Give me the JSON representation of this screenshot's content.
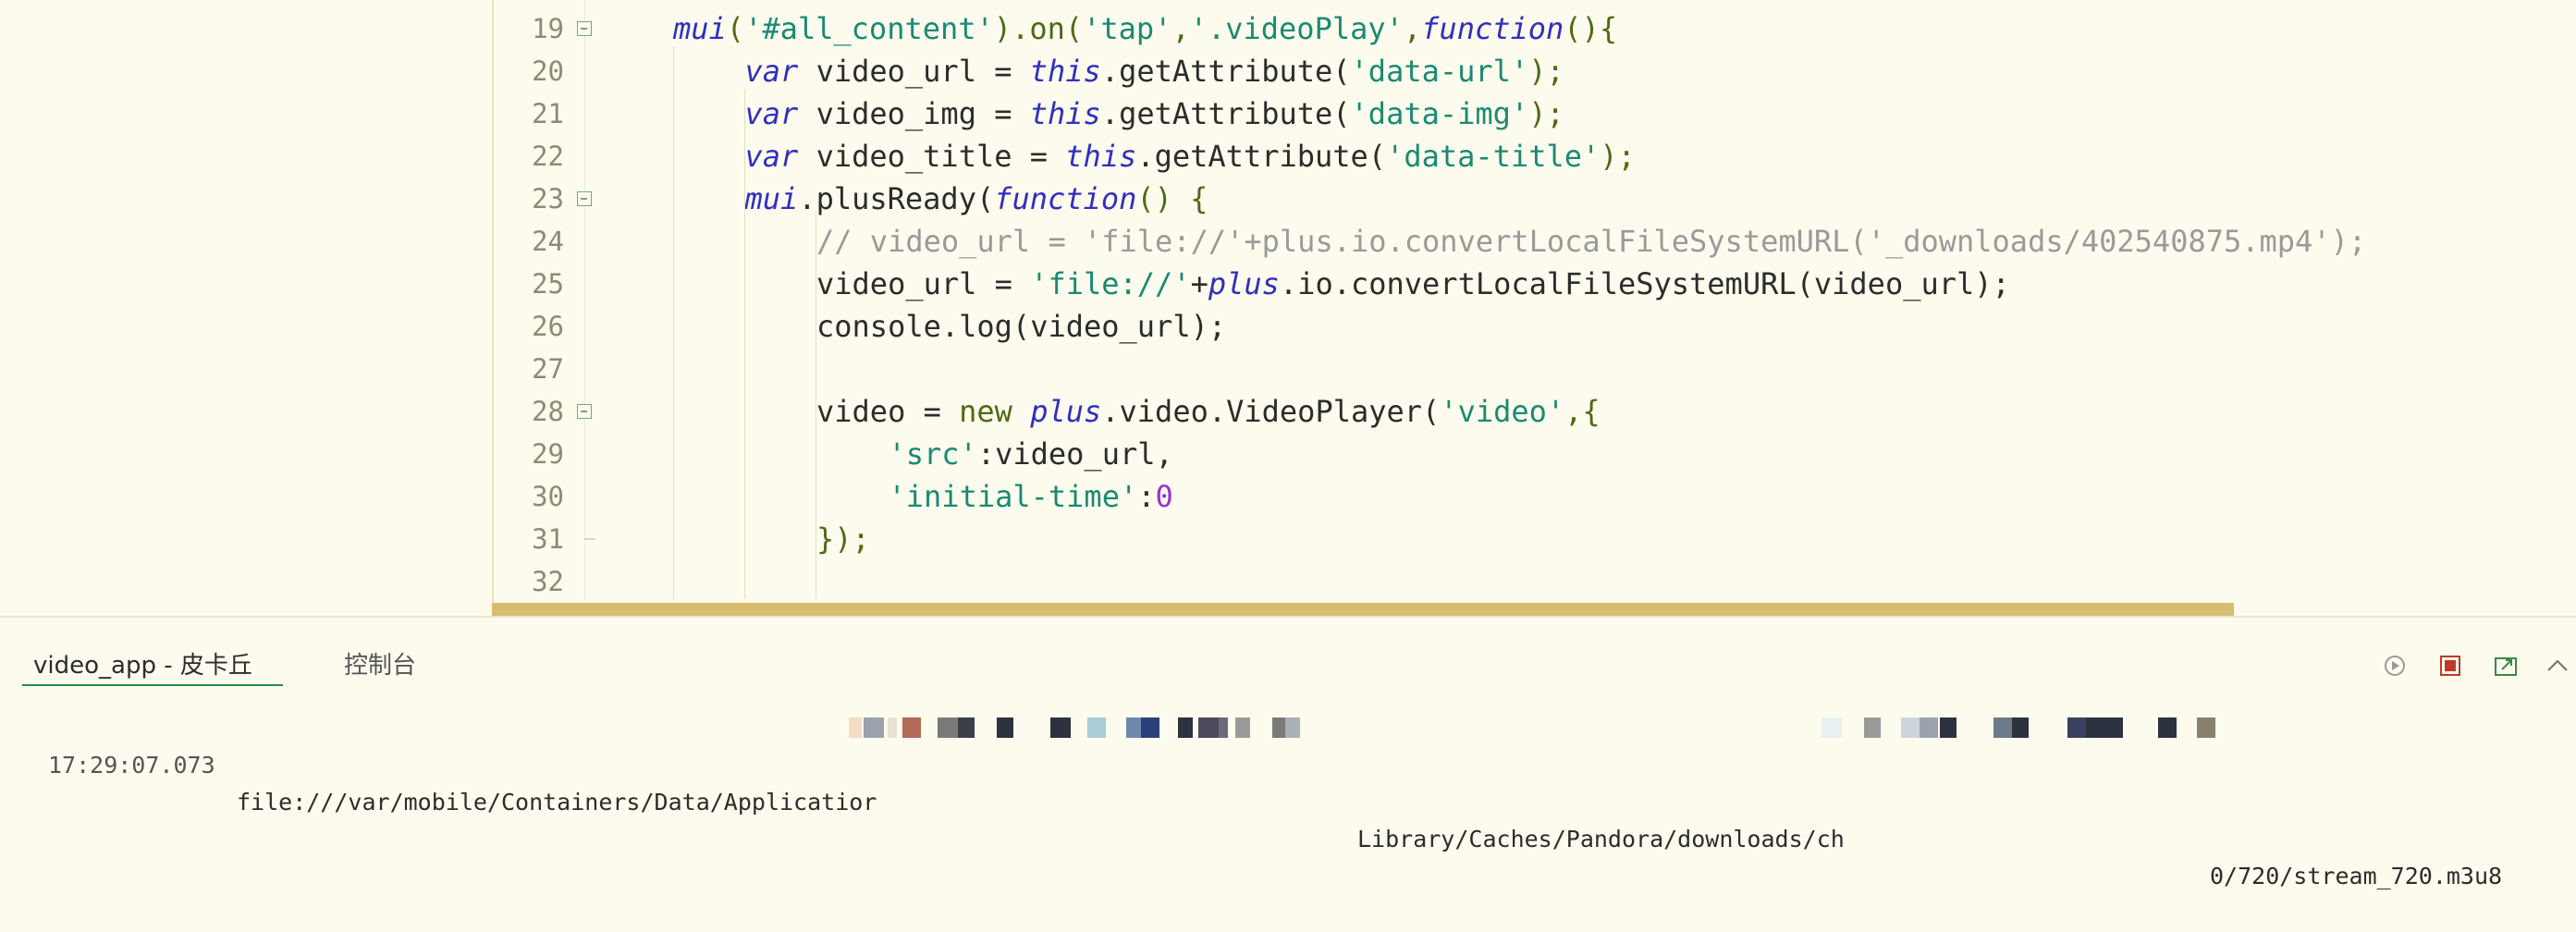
{
  "editor": {
    "lines": [
      {
        "num": "19",
        "indent": 0,
        "tokens": [
          {
            "t": "mui",
            "c": "kw"
          },
          {
            "t": "(",
            "c": "pn"
          },
          {
            "t": "'#all_content'",
            "c": "str"
          },
          {
            "t": ").on(",
            "c": "pn"
          },
          {
            "t": "'tap'",
            "c": "str"
          },
          {
            "t": ",",
            "c": "pn"
          },
          {
            "t": "'.videoPlay'",
            "c": "str"
          },
          {
            "t": ",",
            "c": "pn"
          },
          {
            "t": "function",
            "c": "kw"
          },
          {
            "t": "(){",
            "c": "pn"
          }
        ]
      },
      {
        "num": "20",
        "indent": 1,
        "tokens": [
          {
            "t": "var",
            "c": "kw"
          },
          {
            "t": " video_url = ",
            "c": ""
          },
          {
            "t": "this",
            "c": "kw"
          },
          {
            "t": ".getAttribute(",
            "c": ""
          },
          {
            "t": "'data-url'",
            "c": "str"
          },
          {
            "t": ");",
            "c": "pn"
          }
        ]
      },
      {
        "num": "21",
        "indent": 1,
        "tokens": [
          {
            "t": "var",
            "c": "kw"
          },
          {
            "t": " video_img = ",
            "c": ""
          },
          {
            "t": "this",
            "c": "kw"
          },
          {
            "t": ".getAttribute(",
            "c": ""
          },
          {
            "t": "'data-img'",
            "c": "str"
          },
          {
            "t": ");",
            "c": "pn"
          }
        ]
      },
      {
        "num": "22",
        "indent": 1,
        "tokens": [
          {
            "t": "var",
            "c": "kw"
          },
          {
            "t": " video_title = ",
            "c": ""
          },
          {
            "t": "this",
            "c": "kw"
          },
          {
            "t": ".getAttribute(",
            "c": ""
          },
          {
            "t": "'data-title'",
            "c": "str"
          },
          {
            "t": ");",
            "c": "pn"
          }
        ]
      },
      {
        "num": "23",
        "indent": 1,
        "tokens": [
          {
            "t": "mui",
            "c": "kw"
          },
          {
            "t": ".plusReady(",
            "c": ""
          },
          {
            "t": "function",
            "c": "kw"
          },
          {
            "t": "() {",
            "c": "pn"
          }
        ]
      },
      {
        "num": "24",
        "indent": 2,
        "tokens": [
          {
            "t": "// video_url = 'file://'+plus.io.convertLocalFileSystemURL('_downloads/402540875.mp4');",
            "c": "cm"
          }
        ]
      },
      {
        "num": "25",
        "indent": 2,
        "tokens": [
          {
            "t": "video_url = ",
            "c": ""
          },
          {
            "t": "'file://'",
            "c": "str"
          },
          {
            "t": "+",
            "c": ""
          },
          {
            "t": "plus",
            "c": "kw"
          },
          {
            "t": ".io.convertLocalFileSystemURL(video_url);",
            "c": ""
          }
        ]
      },
      {
        "num": "26",
        "indent": 2,
        "tokens": [
          {
            "t": "console.log(video_url);",
            "c": ""
          }
        ]
      },
      {
        "num": "27",
        "indent": 2,
        "tokens": []
      },
      {
        "num": "28",
        "indent": 2,
        "tokens": [
          {
            "t": "video = ",
            "c": ""
          },
          {
            "t": "new",
            "c": "pn"
          },
          {
            "t": " ",
            "c": ""
          },
          {
            "t": "plus",
            "c": "kw"
          },
          {
            "t": ".video.VideoPlayer(",
            "c": ""
          },
          {
            "t": "'video'",
            "c": "str"
          },
          {
            "t": ",{",
            "c": "pn"
          }
        ]
      },
      {
        "num": "29",
        "indent": 3,
        "tokens": [
          {
            "t": "'src'",
            "c": "str"
          },
          {
            "t": ":video_url,",
            "c": ""
          }
        ]
      },
      {
        "num": "30",
        "indent": 3,
        "tokens": [
          {
            "t": "'initial-time'",
            "c": "str"
          },
          {
            "t": ":",
            "c": ""
          },
          {
            "t": "0",
            "c": "nm"
          }
        ]
      },
      {
        "num": "31",
        "indent": 2,
        "tokens": [
          {
            "t": "});",
            "c": "pn"
          }
        ]
      },
      {
        "num": "32",
        "indent": 2,
        "tokens": []
      }
    ],
    "fold_lines": [
      "19",
      "23",
      "28"
    ],
    "fold_end_lines": [
      "31"
    ]
  },
  "console": {
    "tabs": [
      {
        "label": "video_app - 皮卡丘",
        "active": true
      },
      {
        "label": "控制台",
        "active": false
      }
    ],
    "log": {
      "time": "17:29:07.073",
      "part_a": "file:///var/mobile/Containers/Data/Applicatior",
      "part_b": "Library/Caches/Pandora/downloads/ch",
      "part_c": "0/720/stream_720.m3u8"
    },
    "tools": [
      "run-icon",
      "stop-icon",
      "export-icon",
      "collapse-icon"
    ]
  }
}
